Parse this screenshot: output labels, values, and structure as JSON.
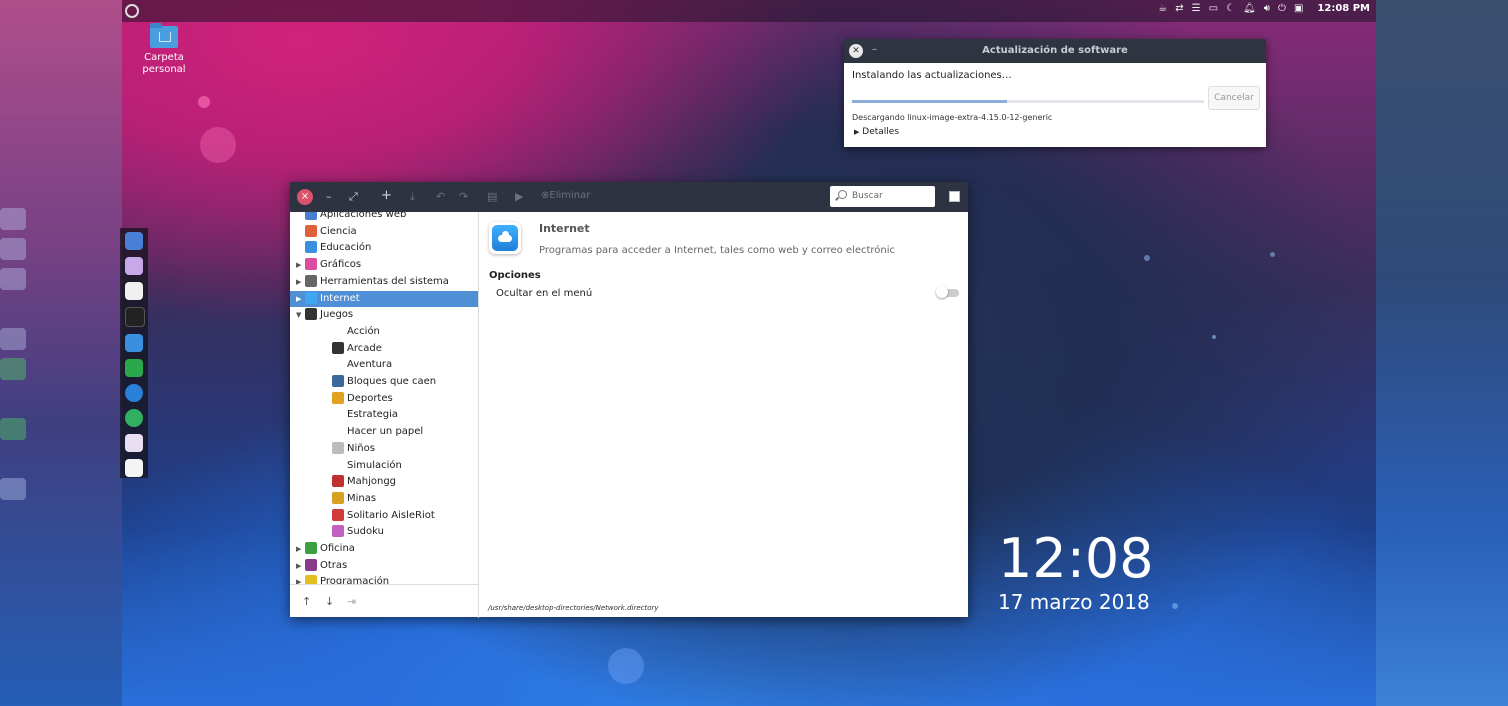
{
  "topbar": {
    "time": "12:08 PM",
    "tray_icons": [
      "cup-icon",
      "network-icon",
      "menu-icon",
      "folder-icon",
      "moon-icon",
      "bell-icon",
      "volume-icon",
      "power-icon",
      "window-icon"
    ]
  },
  "desktop": {
    "home_icon_label": "Carpeta personal",
    "clock_time": "12:08",
    "clock_date": "17 marzo 2018"
  },
  "update_dialog": {
    "title": "Actualización de software",
    "status": "Instalando las actualizaciones…",
    "cancel_label": "Cancelar",
    "progress": 0.44,
    "download_text": "Descargando linux-image-extra-4.15.0-12-generic",
    "details_label": "Detalles"
  },
  "menu_editor": {
    "toolbar": {
      "close": "×",
      "minimize": "–",
      "maximize": "⤢",
      "add": "+",
      "delete_label": "Eliminar",
      "search_placeholder": "Buscar"
    },
    "tree": [
      {
        "label": "Aplicaciones web",
        "level": 0,
        "expander": "",
        "color": "#4a7fd0"
      },
      {
        "label": "Ciencia",
        "level": 0,
        "expander": "",
        "color": "#e0603a"
      },
      {
        "label": "Educación",
        "level": 0,
        "expander": "",
        "color": "#3a8fe0"
      },
      {
        "label": "Gráficos",
        "level": 0,
        "expander": "▶",
        "color": "#d94ea0"
      },
      {
        "label": "Herramientas del sistema",
        "level": 0,
        "expander": "▶",
        "color": "#666"
      },
      {
        "label": "Internet",
        "level": 0,
        "expander": "▶",
        "color": "#3fa6f0",
        "selected": true
      },
      {
        "label": "Juegos",
        "level": 0,
        "expander": "▼",
        "color": "#333"
      },
      {
        "label": "Acción",
        "level": 1,
        "expander": "",
        "color": ""
      },
      {
        "label": "Arcade",
        "level": 1,
        "expander": "",
        "color": "#333"
      },
      {
        "label": "Aventura",
        "level": 1,
        "expander": "",
        "color": ""
      },
      {
        "label": "Bloques que caen",
        "level": 1,
        "expander": "",
        "color": "#3a6a9a"
      },
      {
        "label": "Deportes",
        "level": 1,
        "expander": "",
        "color": "#e0a020"
      },
      {
        "label": "Estrategia",
        "level": 1,
        "expander": "",
        "color": ""
      },
      {
        "label": "Hacer un papel",
        "level": 1,
        "expander": "",
        "color": ""
      },
      {
        "label": "Niños",
        "level": 1,
        "expander": "",
        "color": "#bbb"
      },
      {
        "label": "Simulación",
        "level": 1,
        "expander": "",
        "color": ""
      },
      {
        "label": "Mahjongg",
        "level": 1,
        "expander": "",
        "color": "#c03030"
      },
      {
        "label": "Minas",
        "level": 1,
        "expander": "",
        "color": "#d8a020"
      },
      {
        "label": "Solitario AisleRiot",
        "level": 1,
        "expander": "",
        "color": "#d03a3a"
      },
      {
        "label": "Sudoku",
        "level": 1,
        "expander": "",
        "color": "#c060c0"
      },
      {
        "label": "Oficina",
        "level": 0,
        "expander": "▶",
        "color": "#3aa040"
      },
      {
        "label": "Otras",
        "level": 0,
        "expander": "▶",
        "color": "#8a3a8a"
      },
      {
        "label": "Programación",
        "level": 0,
        "expander": "▶",
        "color": "#e0c020"
      }
    ],
    "detail": {
      "name": "Internet",
      "comment": "Programas para acceder a Internet, tales como web y correo electrónic",
      "options_label": "Opciones",
      "hide_label": "Ocultar en el menú",
      "hide_on": false,
      "path": "/usr/share/desktop-directories/Network.directory"
    }
  }
}
